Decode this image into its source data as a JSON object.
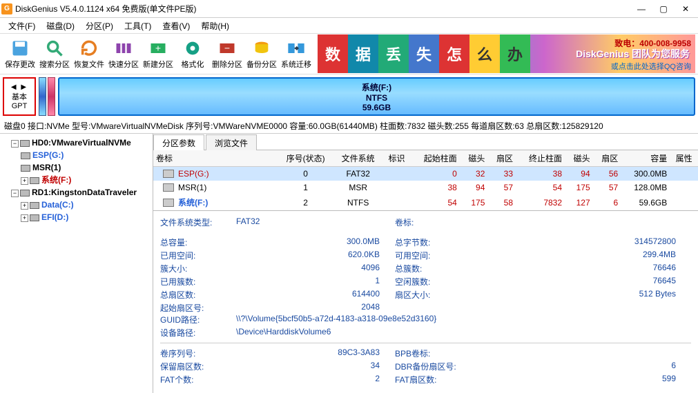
{
  "title": "DiskGenius V5.4.0.1124 x64 免费版(单文件PE版)",
  "menu": [
    "文件(F)",
    "磁盘(D)",
    "分区(P)",
    "工具(T)",
    "查看(V)",
    "帮助(H)"
  ],
  "toolbar": [
    "保存更改",
    "搜索分区",
    "恢复文件",
    "快速分区",
    "新建分区",
    "格式化",
    "删除分区",
    "备份分区",
    "系统迁移"
  ],
  "banner": {
    "tiles": [
      "数",
      "据",
      "丢",
      "失",
      "怎",
      "么",
      "办"
    ],
    "slogan": "DiskGenius 团队为您服务",
    "phone": "致电：400-008-9958",
    "qq": "或点击此处选择QQ咨询"
  },
  "gpt": {
    "l1": "基本",
    "l2": "GPT"
  },
  "diskbar": {
    "name": "系统(F:)",
    "fs": "NTFS",
    "size": "59.6GB"
  },
  "infoline": "磁盘0 接口:NVMe 型号:VMwareVirtualNVMeDisk 序列号:VMWareNVME0000 容量:60.0GB(61440MB) 柱面数:7832 磁头数:255 每道扇区数:63 总扇区数:125829120",
  "tree": {
    "hd0": "HD0:VMwareVirtualNVMe",
    "hd0_items": [
      "ESP(G:)",
      "MSR(1)",
      "系统(F:)"
    ],
    "rd1": "RD1:KingstonDataTraveler",
    "rd1_items": [
      "Data(C:)",
      "EFI(D:)"
    ]
  },
  "tabs": [
    "分区参数",
    "浏览文件"
  ],
  "cols": [
    "卷标",
    "序号(状态)",
    "文件系统",
    "标识",
    "起始柱面",
    "磁头",
    "扇区",
    "终止柱面",
    "磁头",
    "扇区",
    "容量",
    "属性"
  ],
  "rows": [
    {
      "name": "ESP(G:)",
      "seq": "0",
      "fs": "FAT32",
      "flag": "",
      "sc": "0",
      "sh": "32",
      "ss": "33",
      "ec": "38",
      "eh": "94",
      "es": "56",
      "cap": "300.0MB",
      "cls": "sel redname"
    },
    {
      "name": "MSR(1)",
      "seq": "1",
      "fs": "MSR",
      "flag": "",
      "sc": "38",
      "sh": "94",
      "ss": "57",
      "ec": "54",
      "eh": "175",
      "es": "57",
      "cap": "128.0MB",
      "cls": ""
    },
    {
      "name": "系统(F:)",
      "seq": "2",
      "fs": "NTFS",
      "flag": "",
      "sc": "54",
      "sh": "175",
      "ss": "58",
      "ec": "7832",
      "eh": "127",
      "es": "6",
      "cap": "59.6GB",
      "cls": "bluename"
    }
  ],
  "details": {
    "fstype_k": "文件系统类型:",
    "fstype_v": "FAT32",
    "vol_k": "卷标:",
    "pairs1": [
      [
        "总容量:",
        "300.0MB",
        "总字节数:",
        "314572800"
      ],
      [
        "已用空间:",
        "620.0KB",
        "可用空间:",
        "299.4MB"
      ],
      [
        "簇大小:",
        "4096",
        "总簇数:",
        "76646"
      ],
      [
        "已用簇数:",
        "1",
        "空闲簇数:",
        "76645"
      ],
      [
        "总扇区数:",
        "614400",
        "扇区大小:",
        "512 Bytes"
      ],
      [
        "起始扇区号:",
        "2048",
        "",
        ""
      ]
    ],
    "guid_k": "GUID路径:",
    "guid_v": "\\\\?\\Volume{5bcf50b5-a72d-4183-a318-09e8e52d3160}",
    "dev_k": "设备路径:",
    "dev_v": "\\Device\\HarddiskVolume6",
    "pairs2": [
      [
        "卷序列号:",
        "89C3-3A83",
        "BPB卷标:",
        ""
      ],
      [
        "保留扇区数:",
        "34",
        "DBR备份扇区号:",
        "6"
      ],
      [
        "FAT个数:",
        "2",
        "FAT扇区数:",
        "599"
      ]
    ]
  }
}
